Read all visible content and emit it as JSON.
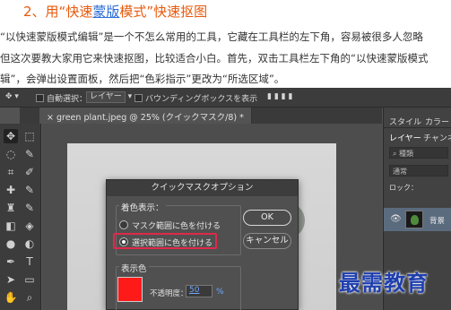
{
  "article": {
    "heading_prefix": "2、用“快速",
    "heading_link": "蒙版",
    "heading_suffix": "模式”快速抠图",
    "line1": "“以快速蒙版模式编辑”是一个不怎么常用的工具，它藏在工具栏的左下角，容易被很多人忽略",
    "line2": "但这次要教大家用它来快速抠图，比较适合小白。首先，双击工具栏左下角的“以快速蒙版模式",
    "line3": "辑”，会弹出设置面板，然后把“色彩指示”更改为“所选区域”。"
  },
  "optbar": {
    "auto_select": "自動選択：",
    "layer_select": "レイヤー",
    "bbox": "バウンディングボックスを表示"
  },
  "document_tab": "green plant.jpeg @ 25% (クイックマスク/8) *",
  "panel": {
    "tab_style": "スタイル",
    "tab_color": "カラー",
    "tab_layers": "レイヤー",
    "tab_channels": "チャンネ",
    "kind": "種類",
    "blend": "通常",
    "lock": "ロック：",
    "layer_name": "背景"
  },
  "dialog": {
    "title": "クイックマスクオプション",
    "color_indicates": "着色表示：",
    "option_masked": "マスク範囲に色を付ける",
    "option_selected": "選択範囲に色を付ける",
    "ok": "OK",
    "cancel": "キャンセル",
    "color_label": "表示色",
    "opacity_label": "不透明度：",
    "opacity_value": "50",
    "opacity_unit": "%"
  },
  "colors": {
    "heading": "#e8590c",
    "highlight_border": "#e0294a",
    "mask_color": "#ff1a1a",
    "watermark": "#1f3fae"
  },
  "watermark": "最需教育"
}
